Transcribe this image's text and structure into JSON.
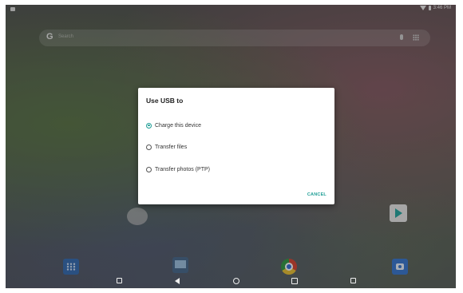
{
  "statusbar": {
    "time": "3:46 PM"
  },
  "search": {
    "logo": "G",
    "placeholder": "Search",
    "icons": [
      "mic-icon",
      "apps-icon"
    ]
  },
  "dialog": {
    "title": "Use USB to",
    "options": [
      {
        "label": "Charge this device",
        "selected": true
      },
      {
        "label": "Transfer files",
        "selected": false
      },
      {
        "label": "Transfer photos (PTP)",
        "selected": false
      }
    ],
    "cancel_label": "CANCEL",
    "accent": "#1f9e96"
  },
  "navbar": {
    "icons": [
      "volume-down-icon",
      "back-icon",
      "home-icon",
      "recents-icon",
      "volume-up-icon"
    ]
  }
}
